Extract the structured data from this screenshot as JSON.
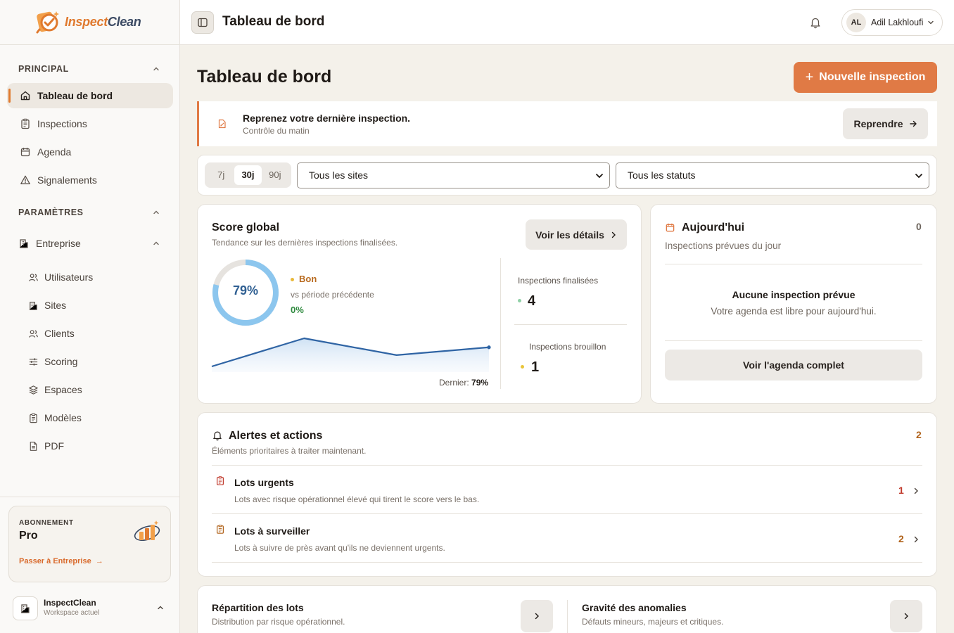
{
  "brand": {
    "name_part1": "Inspect",
    "name_part2": "Clean"
  },
  "sidebar": {
    "principal_label": "PRINCIPAL",
    "principal_items": [
      {
        "label": "Tableau de bord",
        "icon": "home-icon",
        "active": true
      },
      {
        "label": "Inspections",
        "icon": "clipboard-icon",
        "active": false
      },
      {
        "label": "Agenda",
        "icon": "calendar-icon",
        "active": false
      },
      {
        "label": "Signalements",
        "icon": "warning-icon",
        "active": false
      }
    ],
    "settings_label": "PARAMÈTRES",
    "entreprise_label": "Entreprise",
    "entreprise_items": [
      {
        "label": "Utilisateurs",
        "icon": "users-icon"
      },
      {
        "label": "Sites",
        "icon": "building-icon"
      },
      {
        "label": "Clients",
        "icon": "users-icon"
      },
      {
        "label": "Scoring",
        "icon": "sliders-icon"
      },
      {
        "label": "Espaces",
        "icon": "layers-icon"
      },
      {
        "label": "Modèles",
        "icon": "clipboard-icon"
      },
      {
        "label": "PDF",
        "icon": "file-icon"
      }
    ],
    "plan": {
      "kicker": "ABONNEMENT",
      "name": "Pro",
      "upgrade": "Passer à Entreprise"
    },
    "workspace": {
      "name": "InspectClean",
      "sub": "Workspace actuel"
    }
  },
  "topbar": {
    "title": "Tableau de bord",
    "user": {
      "initials": "AL",
      "name": "Adil Lakhloufi"
    }
  },
  "main": {
    "title": "Tableau de bord",
    "new_button": "Nouvelle inspection",
    "resume": {
      "title": "Reprenez votre dernière inspection.",
      "sub": "Contrôle du matin",
      "button": "Reprendre"
    },
    "filters": {
      "periods": [
        "7j",
        "30j",
        "90j"
      ],
      "active_period": "30j",
      "site_select": "Tous les sites",
      "status_select": "Tous les statuts"
    },
    "score": {
      "title": "Score global",
      "sub": "Tendance sur les dernières inspections finalisées.",
      "details_button": "Voir les détails",
      "value_text": "79%",
      "value_fraction": 0.79,
      "rating": "Bon",
      "vs": "vs période précédente",
      "delta": "0%",
      "trend": [
        0.0,
        0.72,
        0.29,
        0.49
      ],
      "last_label": "Dernier:",
      "last_value": "79%",
      "finalized_label": "Inspections finalisées",
      "finalized_value": "4",
      "draft_label": "Inspections brouillon",
      "draft_value": "1"
    },
    "today": {
      "title": "Aujourd'hui",
      "sub": "Inspections prévues du jour",
      "count": "0",
      "empty_title": "Aucune inspection prévue",
      "empty_sub": "Votre agenda est libre pour aujourd'hui.",
      "button": "Voir l'agenda complet"
    },
    "alerts": {
      "title": "Alertes et actions",
      "sub": "Éléments prioritaires à traiter maintenant.",
      "count": "2",
      "items": [
        {
          "title": "Lots urgents",
          "sub": "Lots avec risque opérationnel élevé qui tirent le score vers le bas.",
          "count": "1",
          "color": "#c0392b"
        },
        {
          "title": "Lots à surveiller",
          "sub": "Lots à suivre de près avant qu'ils ne deviennent urgents.",
          "count": "2",
          "color": "#b0621a"
        }
      ]
    },
    "distribution": {
      "title": "Répartition des lots",
      "sub": "Distribution par risque opérationnel."
    },
    "severity": {
      "title": "Gravité des anomalies",
      "sub": "Défauts mineurs, majeurs et critiques."
    }
  },
  "colors": {
    "accent": "#e07a45",
    "ring": "#8cc6ee",
    "trend_line": "#2f64a4"
  }
}
